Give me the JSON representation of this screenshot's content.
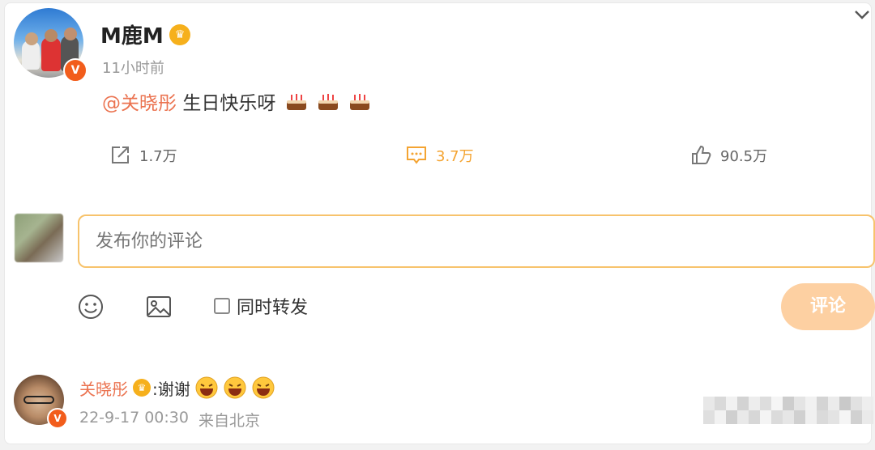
{
  "post": {
    "author": "M鹿M",
    "time": "11小时前",
    "mention": "@关晓彤",
    "text": "生日快乐呀",
    "emoji_count": 3
  },
  "actions": {
    "repost_count": "1.7万",
    "comment_count": "3.7万",
    "like_count": "90.5万"
  },
  "composer": {
    "placeholder": "发布你的评论",
    "repost_checkbox_label": "同时转发",
    "submit_label": "评论"
  },
  "comment": {
    "author": "关晓彤",
    "text": ":谢谢",
    "date": "22-9-17 00:30",
    "location": "来自北京"
  },
  "colors": {
    "accent": "#eb7350",
    "active_action": "#f4a432",
    "input_border": "#f7c36c",
    "submit_disabled": "#fdd0a2",
    "verified_badge": "#f25d1c"
  }
}
